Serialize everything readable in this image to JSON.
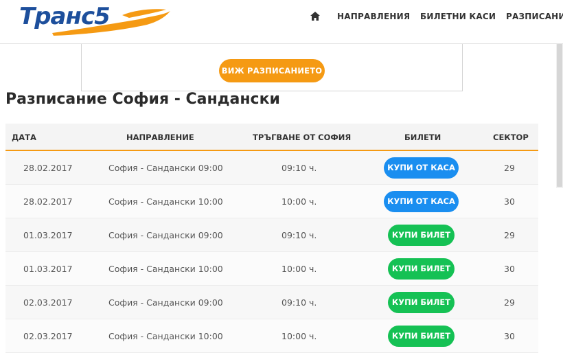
{
  "brand": {
    "logo_text": "Транс5",
    "logo_color": "#1d4f9c",
    "accent_color": "#f59a13"
  },
  "nav": {
    "home_icon": "home-icon",
    "items": [
      "НАПРАВЛЕНИЯ",
      "БИЛЕТНИ КАСИ",
      "РАЗПИСАНИЕ"
    ]
  },
  "schedule_button": "ВИЖ РАЗПИСАНИЕТО",
  "page_title": "Разписание София - Сандански",
  "table": {
    "headers": [
      "ДАТА",
      "НАПРАВЛЕНИЕ",
      "ТРЪГВАНЕ ОТ СОФИЯ",
      "БИЛЕТИ",
      "СЕКТОР"
    ],
    "rows": [
      {
        "date": "28.02.2017",
        "direction": "София - Сандански 09:00",
        "departure": "09:10 ч.",
        "ticket": "КУПИ ОТ КАСА",
        "ticket_type": "office",
        "sector": "29"
      },
      {
        "date": "28.02.2017",
        "direction": "София - Сандански 10:00",
        "departure": "10:00 ч.",
        "ticket": "КУПИ ОТ КАСА",
        "ticket_type": "office",
        "sector": "30"
      },
      {
        "date": "01.03.2017",
        "direction": "София - Сандански 09:00",
        "departure": "09:10 ч.",
        "ticket": "КУПИ БИЛЕТ",
        "ticket_type": "online",
        "sector": "29"
      },
      {
        "date": "01.03.2017",
        "direction": "София - Сандански 10:00",
        "departure": "10:00 ч.",
        "ticket": "КУПИ БИЛЕТ",
        "ticket_type": "online",
        "sector": "30"
      },
      {
        "date": "02.03.2017",
        "direction": "София - Сандански 09:00",
        "departure": "09:10 ч.",
        "ticket": "КУПИ БИЛЕТ",
        "ticket_type": "online",
        "sector": "29"
      },
      {
        "date": "02.03.2017",
        "direction": "София - Сандански 10:00",
        "departure": "10:00 ч.",
        "ticket": "КУПИ БИЛЕТ",
        "ticket_type": "online",
        "sector": "30"
      }
    ]
  }
}
